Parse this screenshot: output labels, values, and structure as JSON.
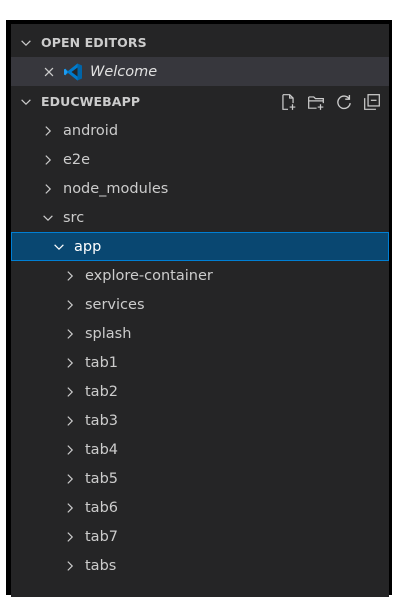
{
  "sections": {
    "open_editors": {
      "title": "OPEN EDITORS",
      "items": [
        {
          "label": "Welcome",
          "icon": "vscode-logo-icon",
          "italic": true
        }
      ]
    },
    "project": {
      "title": "EDUCWEBAPP",
      "actions": [
        "new-file-icon",
        "new-folder-icon",
        "refresh-icon",
        "collapse-all-icon"
      ]
    }
  },
  "tree": [
    {
      "label": "android",
      "depth": 0,
      "expanded": false
    },
    {
      "label": "e2e",
      "depth": 0,
      "expanded": false
    },
    {
      "label": "node_modules",
      "depth": 0,
      "expanded": false
    },
    {
      "label": "src",
      "depth": 0,
      "expanded": true
    },
    {
      "label": "app",
      "depth": 1,
      "expanded": true,
      "selected": true
    },
    {
      "label": "explore-container",
      "depth": 2,
      "expanded": false
    },
    {
      "label": "services",
      "depth": 2,
      "expanded": false
    },
    {
      "label": "splash",
      "depth": 2,
      "expanded": false
    },
    {
      "label": "tab1",
      "depth": 2,
      "expanded": false
    },
    {
      "label": "tab2",
      "depth": 2,
      "expanded": false
    },
    {
      "label": "tab3",
      "depth": 2,
      "expanded": false
    },
    {
      "label": "tab4",
      "depth": 2,
      "expanded": false
    },
    {
      "label": "tab5",
      "depth": 2,
      "expanded": false
    },
    {
      "label": "tab6",
      "depth": 2,
      "expanded": false
    },
    {
      "label": "tab7",
      "depth": 2,
      "expanded": false
    },
    {
      "label": "tabs",
      "depth": 2,
      "expanded": false
    }
  ],
  "colors": {
    "background": "#252526",
    "text": "#cccccc",
    "selection": "#094771",
    "selection_border": "#007fd4",
    "vscode_blue": "#007acc"
  }
}
